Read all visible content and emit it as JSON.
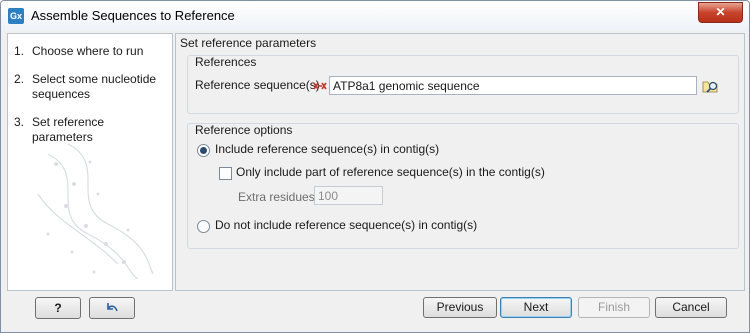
{
  "window": {
    "title": "Assemble Sequences to Reference",
    "app_icon": "Gx",
    "close_glyph": "✕"
  },
  "steps": [
    {
      "number": "1.",
      "label": "Choose where to run"
    },
    {
      "number": "2.",
      "label": "Select some nucleotide sequences"
    },
    {
      "number": "3.",
      "label": "Set reference parameters"
    }
  ],
  "content": {
    "section_title": "Set reference parameters",
    "references": {
      "group_title": "References",
      "field_label": "Reference sequence(s)",
      "value": "ATP8a1 genomic sequence"
    },
    "reference_options": {
      "group_title": "Reference options",
      "include_label": "Include reference sequence(s) in contig(s)",
      "include_checked": true,
      "only_part_label": "Only include part of reference sequence(s) in the contig(s)",
      "only_part_checked": false,
      "extra_residues_label": "Extra residues",
      "extra_residues_value": "100",
      "exclude_label": "Do not include reference sequence(s) in contig(s)",
      "exclude_checked": false
    }
  },
  "footer": {
    "help_label": "?",
    "previous_label": "Previous",
    "next_label": "Next",
    "finish_label": "Finish",
    "cancel_label": "Cancel"
  },
  "colors": {
    "accent": "#2d7fc1",
    "sequence_icon": "#c0392b",
    "close_button": "#c7442b"
  }
}
